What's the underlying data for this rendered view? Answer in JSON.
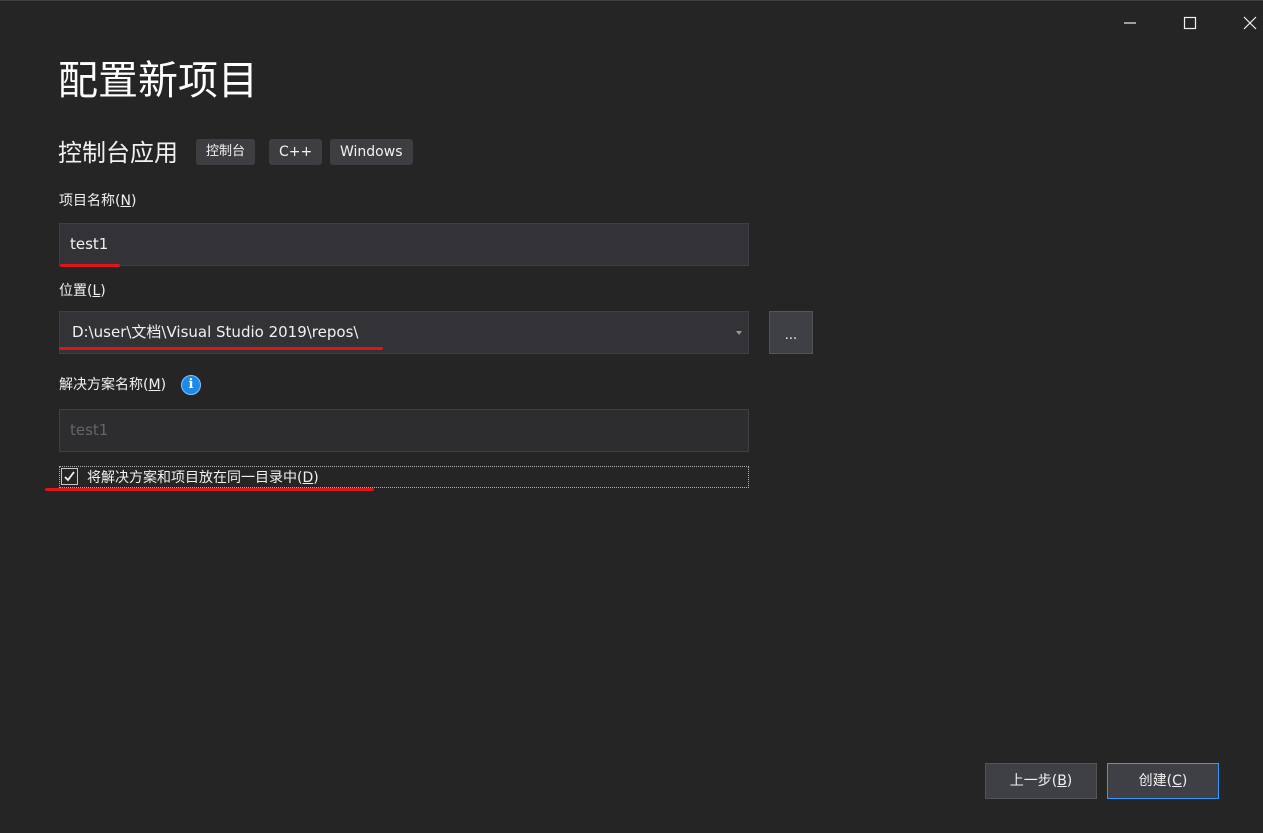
{
  "window": {
    "icons": {
      "minimize": "minimize-icon",
      "maximize": "maximize-icon",
      "close": "close-icon"
    }
  },
  "header": {
    "title": "配置新项目",
    "template_name": "控制台应用",
    "tags": [
      "控制台",
      "C++",
      "Windows"
    ]
  },
  "form": {
    "project_name": {
      "label": "项目名称(",
      "mnemonic": "N",
      "label_end": ")",
      "value": "test1"
    },
    "location": {
      "label": "位置(",
      "mnemonic": "L",
      "label_end": ")",
      "value": "D:\\user\\文档\\Visual Studio 2019\\repos\\",
      "browse_label": "..."
    },
    "solution_name": {
      "label": "解决方案名称(",
      "mnemonic": "M",
      "label_end": ")",
      "value": "test1",
      "info_glyph": "i"
    },
    "same_dir": {
      "checked": true,
      "label": "将解决方案和项目放在同一目录中(",
      "mnemonic": "D",
      "label_end": ")"
    }
  },
  "footer": {
    "back": {
      "label": "上一步(",
      "mnemonic": "B",
      "label_end": ")"
    },
    "create": {
      "label": "创建(",
      "mnemonic": "C",
      "label_end": ")"
    }
  },
  "colors": {
    "background": "#252526",
    "input_bg": "#333337",
    "accent": "#3399ff",
    "annotation_red": "#e0141b",
    "info_blue": "#1e8ae6"
  }
}
